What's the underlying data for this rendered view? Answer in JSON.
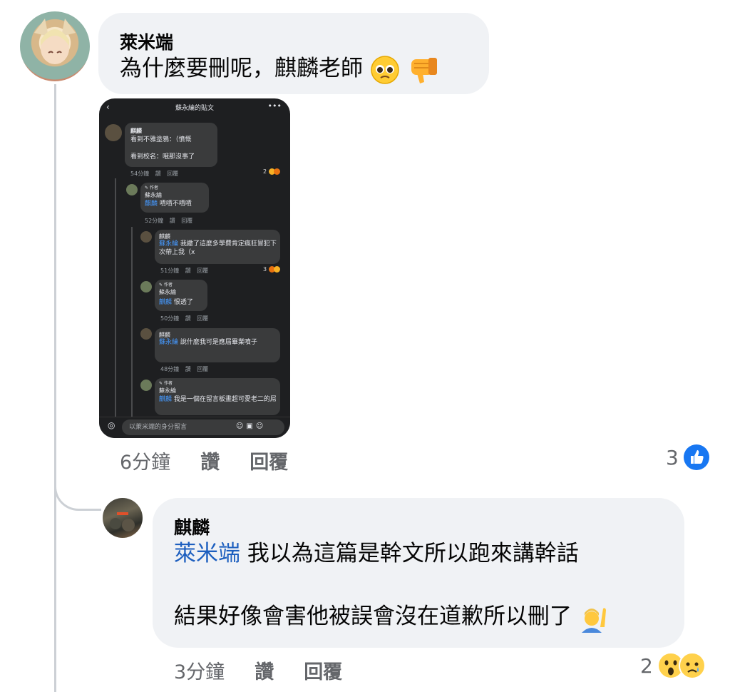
{
  "comment1": {
    "author": "萊米端",
    "text": "為什麼要刪呢，麒麟老師",
    "time": "6分鐘",
    "like_label": "讚",
    "reply_label": "回覆",
    "reaction_count": "3",
    "reaction_icons": [
      "like-icon"
    ],
    "text_emojis": [
      "pleading-face-icon",
      "thumbs-down-icon"
    ]
  },
  "screenshot": {
    "header_title": "蘇永綸的貼文",
    "input_placeholder": "以萊米端的身分留言",
    "comments": [
      {
        "name": "麒麟",
        "lines": [
          "看到不雅塗鴉：（憤慨",
          "",
          "看到校名：哦那沒事了"
        ],
        "time": "54分鐘",
        "like": "讚",
        "reply": "回覆",
        "react": "2"
      },
      {
        "badge": "作者",
        "name": "蘇永綸",
        "mention": "麒麟",
        "text": "嘖嘖不嘖嘖",
        "time": "52分鐘",
        "like": "讚",
        "reply": "回覆"
      },
      {
        "name": "麒麟",
        "mention": "蘇永綸",
        "text": "我繳了這麼多學費肯定瘋狂冒犯下次帶上我（x",
        "time": "51分鐘",
        "like": "讚",
        "reply": "回覆",
        "react": "3"
      },
      {
        "badge": "作者",
        "name": "蘇永綸",
        "mention": "麒麟",
        "text": "恨透了",
        "time": "50分鐘",
        "like": "讚",
        "reply": "回覆"
      },
      {
        "name": "麒麟",
        "mention": "蘇永綸",
        "text": "說什麼我可是應屆畢業噴子",
        "time": "48分鐘",
        "like": "讚",
        "reply": "回覆"
      },
      {
        "badge": "作者",
        "name": "蘇永綸",
        "mention": "麒麟",
        "text": "我是一個在留言板畫超可愛老二的屌"
      }
    ]
  },
  "comment2": {
    "author": "麒麟",
    "mention": "萊米端",
    "line1": "我以為這篇是幹文所以跑來講幹話",
    "line2": "結果好像會害他被誤會沒在道歉所以刪了",
    "time": "3分鐘",
    "like_label": "讚",
    "reply_label": "回覆",
    "reaction_count": "2",
    "reaction_icons": [
      "wow-icon",
      "sad-icon"
    ],
    "text_emojis": [
      "person-raising-hand-icon"
    ]
  },
  "colors": {
    "mention": "#1d5fbf",
    "like_blue": "#1877f2",
    "bubble": "#f0f2f5",
    "meta": "#65676b"
  }
}
